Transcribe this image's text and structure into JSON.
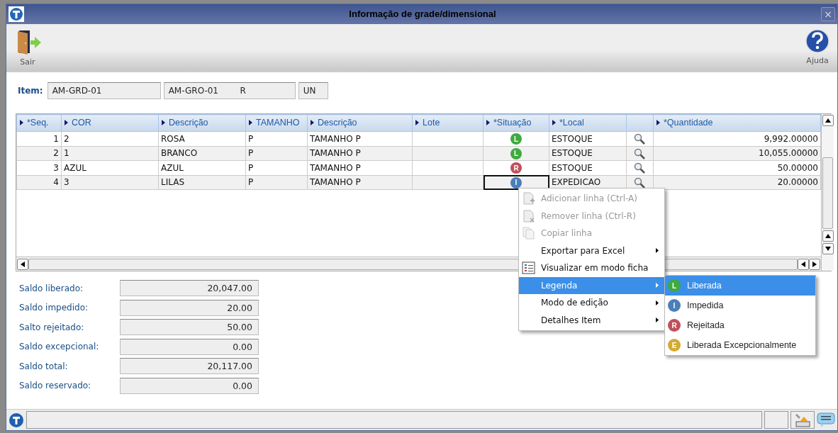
{
  "window": {
    "title": "Informação de grade/dimensional",
    "close": "×"
  },
  "toolbar": {
    "left": {
      "label": "Sair"
    },
    "right": {
      "label": "Ajuda"
    }
  },
  "item": {
    "label": "Item:",
    "fields": [
      {
        "value": "AM-GRD-01"
      },
      {
        "value": "AM-GRO-01        R"
      },
      {
        "value": "UN"
      }
    ]
  },
  "table": {
    "columns": [
      {
        "label": "*Seq.",
        "kind": "number"
      },
      {
        "label": "COR",
        "kind": "text"
      },
      {
        "label": "Descrição",
        "kind": "text"
      },
      {
        "label": "TAMANHO",
        "kind": "text"
      },
      {
        "label": "Descrição",
        "kind": "text"
      },
      {
        "label": "Lote",
        "kind": "text"
      },
      {
        "label": "*Situação",
        "kind": "status"
      },
      {
        "label": "*Local",
        "kind": "text"
      },
      {
        "kind": "lookup"
      },
      {
        "label": "*Quantidade",
        "kind": "number"
      }
    ],
    "rows": [
      {
        "cells": [
          "1",
          "2",
          "ROSA",
          "P",
          "TAMANHO P",
          "",
          {
            "badge": "L",
            "color": "#3faa3f"
          },
          "ESTOQUE",
          null,
          "9,992.00000"
        ],
        "focused": false
      },
      {
        "cells": [
          "2",
          "1",
          "BRANCO",
          "P",
          "TAMANHO P",
          "",
          {
            "badge": "L",
            "color": "#3faa3f"
          },
          "ESTOQUE",
          null,
          "10,055.00000"
        ],
        "focused": false
      },
      {
        "cells": [
          "3",
          "AZUL",
          "AZUL",
          "P",
          "TAMANHO P",
          "",
          {
            "badge": "R",
            "color": "#c0505a"
          },
          "ESTOQUE",
          null,
          "50.00000"
        ],
        "focused": false
      },
      {
        "cells": [
          "4",
          "3",
          "LILAS",
          "P",
          "TAMANHO P",
          "",
          {
            "badge": "I",
            "color": "#4a7fb8"
          },
          "EXPEDICAO",
          null,
          "20.00000"
        ],
        "focused": true
      }
    ]
  },
  "summary": [
    {
      "label": "Saldo liberado:",
      "value": "20,047.00"
    },
    {
      "label": "Saldo impedido:",
      "value": "20.00"
    },
    {
      "label": "Salto rejeitado:",
      "value": "50.00"
    },
    {
      "label": "Saldo excepcional:",
      "value": "0.00"
    },
    {
      "label": "Saldo total:",
      "value": "20,117.00"
    },
    {
      "label": "Saldo reservado:",
      "value": "0.00"
    }
  ],
  "context_menu": {
    "items": [
      {
        "label": "Adicionar linha (Ctrl-A)",
        "kind": "add",
        "disabled": true,
        "selected": false
      },
      {
        "label": "Remover linha (Ctrl-R)",
        "kind": "remove",
        "disabled": true,
        "selected": false
      },
      {
        "label": "Copiar linha",
        "kind": "copy",
        "disabled": true,
        "selected": false
      },
      {
        "label": "Exportar para Excel",
        "kind": "submenu",
        "disabled": false,
        "selected": false
      },
      {
        "label": "Visualizar em modo ficha",
        "kind": "form",
        "disabled": false,
        "selected": false
      },
      {
        "label": "Legenda",
        "kind": "submenu",
        "disabled": false,
        "selected": true
      },
      {
        "label": "Modo de edição",
        "kind": "submenu",
        "disabled": false,
        "selected": false
      },
      {
        "label": "Detalhes Item",
        "kind": "submenu",
        "disabled": false,
        "selected": false
      }
    ],
    "submenu": [
      {
        "badge": "L",
        "label": "Liberada",
        "color": "#3faa3f",
        "selected": true
      },
      {
        "badge": "I",
        "label": "Impedida",
        "color": "#4a7fb8",
        "selected": false
      },
      {
        "badge": "R",
        "label": "Rejeitada",
        "color": "#c0505a",
        "selected": false
      },
      {
        "badge": "E",
        "label": "Liberada Excepcionalmente",
        "color": "#d4aa33",
        "selected": false
      }
    ]
  }
}
